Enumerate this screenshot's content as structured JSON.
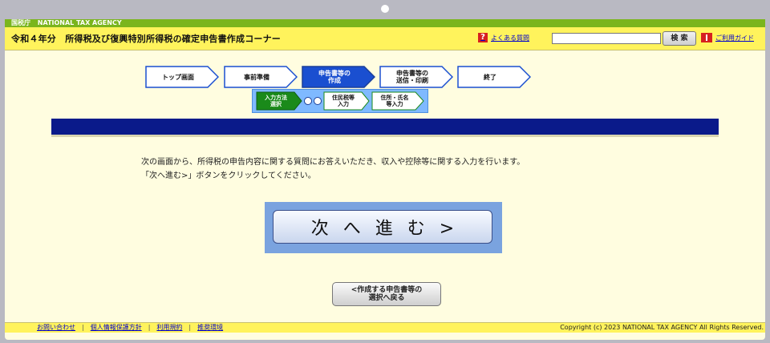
{
  "header": {
    "agency_ja": "国税庁",
    "agency_en": "NATIONAL TAX AGENCY",
    "title": "令和４年分　所得税及び復興特別所得税の確定申告書作成コーナー",
    "faq_label": "よくある質問",
    "faq_icon": "question-icon",
    "search_placeholder": "",
    "search_button": "検 索",
    "guide_label": "ご利用ガイド",
    "guide_icon": "book-icon"
  },
  "steps": [
    {
      "label": "トップ画面",
      "active": false
    },
    {
      "label": "事前準備",
      "active": false
    },
    {
      "label": "申告書等の\n作成",
      "active": true
    },
    {
      "label": "申告書等の\n送信・印刷",
      "active": false
    },
    {
      "label": "終了",
      "active": false
    }
  ],
  "substeps": [
    {
      "label": "入力方法\n選択",
      "active": true
    },
    {
      "label": "住民税等\n入力",
      "active": false
    },
    {
      "label": "住所・氏名\n等入力",
      "active": false
    }
  ],
  "message": {
    "line1": "次の画面から、所得税の申告内容に関する質問にお答えいただき、収入や控除等に関する入力を行います。",
    "line2": "「次へ進む>」ボタンをクリックしてください。"
  },
  "buttons": {
    "next": "次へ進む>",
    "back": "<作成する申告書等の\n選択へ戻る"
  },
  "footer": {
    "links": [
      "お問い合わせ",
      "個人情報保護方針",
      "利用規約",
      "推奨環境"
    ],
    "copyright": "Copyright (c) 2023 NATIONAL TAX AGENCY All Rights Reserved."
  },
  "colors": {
    "agency_bar": "#7ab51d",
    "header_yellow": "#fff35c",
    "page_bg": "#fffde0",
    "navy_bar": "#0a1a8a",
    "active_step": "#1a4fd0",
    "active_substep": "#1a8a1a"
  }
}
